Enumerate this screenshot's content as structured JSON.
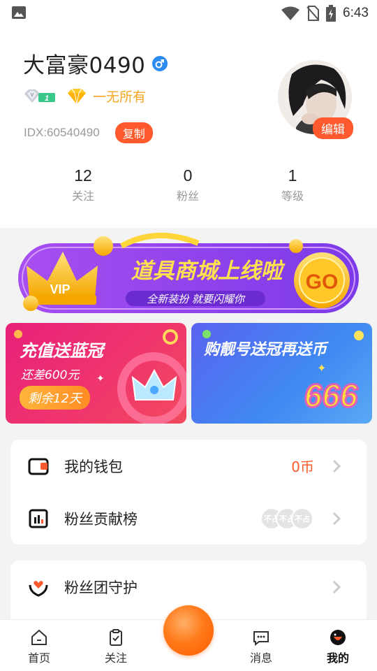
{
  "status_bar": {
    "time": "6:43"
  },
  "profile": {
    "username": "大富豪0490",
    "vip_level": "1",
    "wealth_label": "一无所有",
    "idx": "IDX:60540490",
    "copy_label": "复制",
    "edit_label": "编辑",
    "stats": [
      {
        "value": "12",
        "label": "关注"
      },
      {
        "value": "0",
        "label": "粉丝"
      },
      {
        "value": "1",
        "label": "等级"
      }
    ]
  },
  "banner": {
    "title": "道具商城上线啦",
    "subtitle": "全新装扮 就要闪耀你",
    "vip": "VIP",
    "go": "GO"
  },
  "promos": {
    "left": {
      "title": "充值送蓝冠",
      "subtitle": "还差600元",
      "pill": "剩余12天"
    },
    "right": {
      "title": "购靓号送冠再送币",
      "badge": "666"
    }
  },
  "menu": {
    "wallet": {
      "label": "我的钱包",
      "value": "0币"
    },
    "fans_rank": {
      "label": "粉丝贡献榜",
      "avatar_text": "不占"
    },
    "fan_guard": {
      "label": "粉丝团守护"
    }
  },
  "bottom_nav": [
    {
      "label": "首页"
    },
    {
      "label": "关注"
    },
    {
      "label": "消息"
    },
    {
      "label": "我的"
    }
  ],
  "colors": {
    "accent": "#ff5a2e",
    "gold": "#f5a623"
  }
}
